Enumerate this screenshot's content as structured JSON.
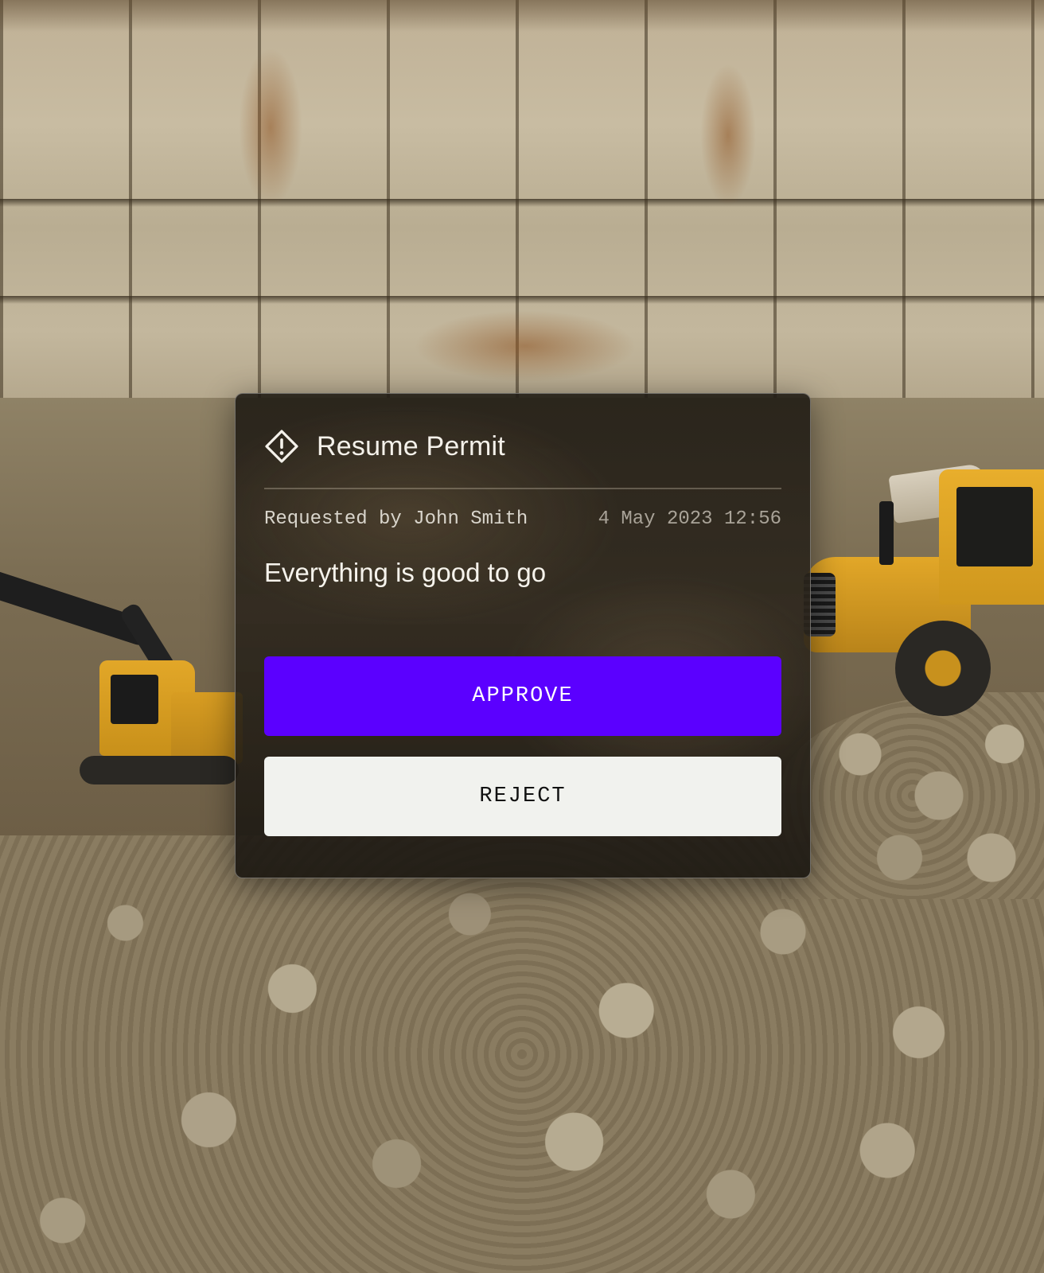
{
  "colors": {
    "accent": "#5b00ff",
    "reject_bg": "#f1f2ee",
    "card_text": "#f4f1ea"
  },
  "background": {
    "description_icon": "quarry-photo"
  },
  "permit": {
    "icon": "alert-diamond-icon",
    "title": "Resume Permit",
    "requested_by": "Requested by John Smith",
    "timestamp": "4 May 2023 12:56",
    "message": "Everything is good to go",
    "approve_label": "APPROVE",
    "reject_label": "REJECT"
  }
}
